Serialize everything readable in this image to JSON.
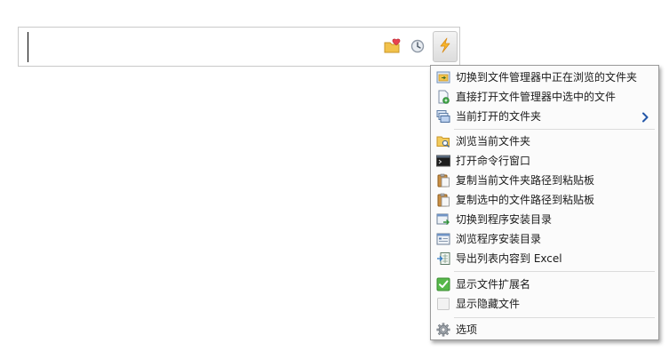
{
  "search": {
    "value": ""
  },
  "toolbar": {
    "favorites_icon": "folder-heart-icon",
    "history_icon": "clock-icon",
    "actions_icon": "lightning-bolt-icon"
  },
  "menu": {
    "groups": [
      [
        {
          "label": "切换到文件管理器中正在浏览的文件夹",
          "icon": "folder-switch-icon"
        },
        {
          "label": "直接打开文件管理器中选中的文件",
          "icon": "open-file-icon"
        },
        {
          "label": "当前打开的文件夹",
          "icon": "windows-stack-icon",
          "submenu": true
        }
      ],
      [
        {
          "label": "浏览当前文件夹",
          "icon": "folder-browse-icon"
        },
        {
          "label": "打开命令行窗口",
          "icon": "terminal-icon"
        },
        {
          "label": "复制当前文件夹路径到粘贴板",
          "icon": "clipboard-folder-icon"
        },
        {
          "label": "复制选中的文件路径到粘贴板",
          "icon": "clipboard-file-icon"
        },
        {
          "label": "切换到程序安装目录",
          "icon": "program-switch-icon"
        },
        {
          "label": "浏览程序安装目录",
          "icon": "program-browse-icon"
        },
        {
          "label": "导出列表内容到 Excel",
          "icon": "export-excel-icon"
        }
      ],
      [
        {
          "label": "显示文件扩展名",
          "icon": "checkbox-checked-icon"
        },
        {
          "label": "显示隐藏文件",
          "icon": "checkbox-unchecked-icon"
        }
      ],
      [
        {
          "label": "选项",
          "icon": "gear-icon"
        }
      ]
    ]
  }
}
